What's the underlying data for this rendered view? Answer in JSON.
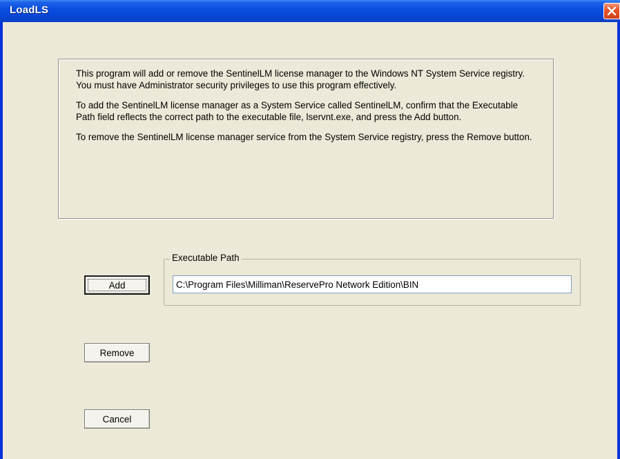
{
  "window": {
    "title": "LoadLS"
  },
  "info": {
    "paragraphs": [
      "This program will add or remove the SentinelLM license manager to the Windows NT System Service registry. You must have Administrator security privileges to use this program effectively.",
      "To add the SentinelLM license manager as a System Service called SentinelLM, confirm that the Executable Path field reflects the correct path to the executable file, lservnt.exe, and press the Add button.",
      "To remove the SentinelLM license manager service from the System Service registry, press the Remove button."
    ]
  },
  "path_group": {
    "label": "Executable Path",
    "value": "C:\\Program Files\\Milliman\\ReservePro Network Edition\\BIN"
  },
  "buttons": {
    "add": "Add",
    "remove": "Remove",
    "cancel": "Cancel"
  },
  "icons": {
    "close": "close-icon"
  },
  "colors": {
    "titlebar": "#0a4fdf",
    "window_bg": "#ece9d8",
    "close_button": "#e4562a"
  }
}
